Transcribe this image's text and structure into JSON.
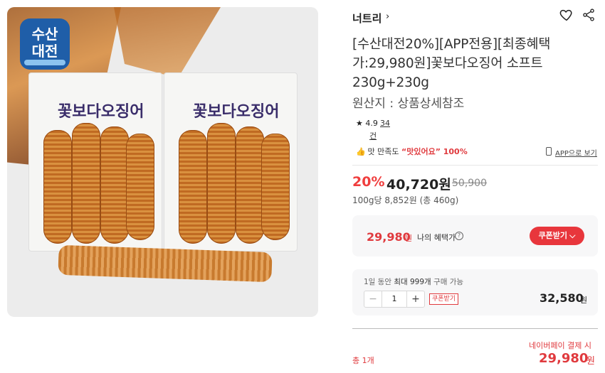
{
  "image": {
    "badge_line1": "수산",
    "badge_line2": "대전",
    "pack_label": "꽃보다오징어",
    "badge_color": "#1f5ea8"
  },
  "store": {
    "name": "너트리",
    "chevron": "›"
  },
  "icons": {
    "wishlist": "heart-icon",
    "share": "share-icon"
  },
  "product": {
    "title": "[수산대전20%][APP전용][최종혜택가:29,980원]꽃보다오징어 소프트 230g+230g",
    "origin": "원산지 : 상품상세참조",
    "rating": "★ 4.9",
    "reviews": "34",
    "reviews_unit": "건",
    "taste_prefix": "맛 만족도",
    "taste_quote": "“맛있어요” 100%",
    "app_view": "APP으로 보기"
  },
  "pricing": {
    "discount": "20%",
    "price": "40,720원",
    "original": "50,900",
    "unit_price": "100g당 8,852원 (총 460g)"
  },
  "benefit": {
    "price": "29,980",
    "won": "원",
    "label": "나의 혜택가",
    "info": "?",
    "coupon_button": "쿠폰받기 ⌵"
  },
  "quantity": {
    "limit_prefix": "1일 동안",
    "limit_text": "최대 999개",
    "limit_suffix": "구매 가능",
    "minus": "−",
    "value": "1",
    "plus": "+",
    "coupon_badge": "쿠폰받기",
    "line_price": "32,580",
    "won": "원"
  },
  "total": {
    "label": "총 1개",
    "pay_label": "네이버페이 결제 시",
    "price": "29,980",
    "won": "원"
  },
  "colors": {
    "accent": "#e8363c",
    "text": "#222222",
    "muted": "#888888"
  }
}
